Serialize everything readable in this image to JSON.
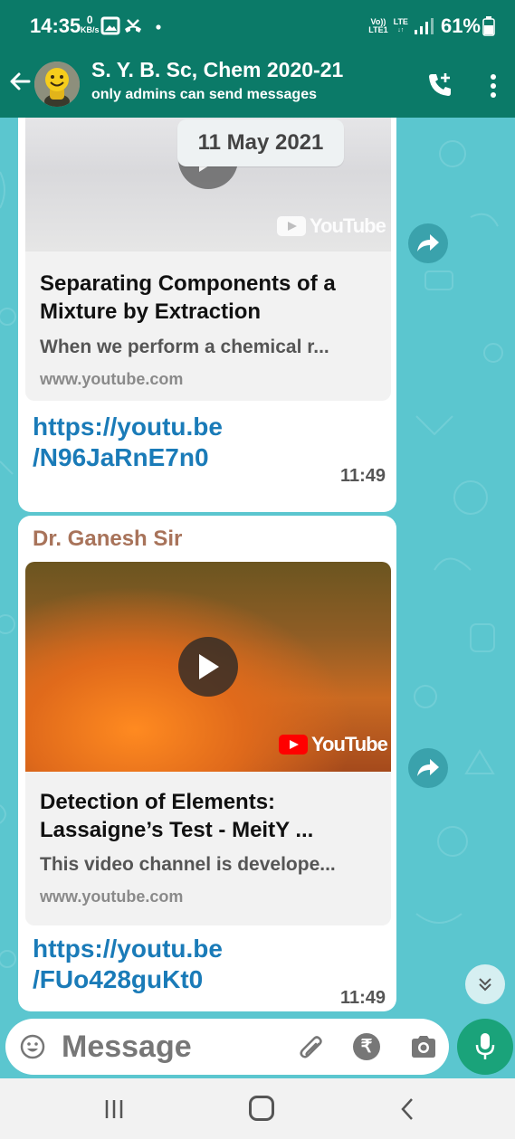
{
  "status_bar": {
    "time": "14:35",
    "net_speed_value": "0",
    "net_speed_unit": "KB/s",
    "dot": "•",
    "volte_top": "Vo))",
    "volte_bottom": "LTE1",
    "lte": "LTE",
    "battery": "61%"
  },
  "header": {
    "title": "S. Y. B. Sc, Chem 2020-21",
    "subtitle": "only admins can send messages",
    "icons": [
      "back-arrow-icon",
      "avatar",
      "add-call-icon",
      "more-vertical-icon"
    ]
  },
  "chat": {
    "date_chip": "11 May 2021",
    "messages": [
      {
        "sender": "",
        "preview_title": "Separating Components of a Mixture by Extraction",
        "preview_description": "When we perform a chemical r...",
        "preview_domain": "www.youtube.com",
        "youtube_label": "YouTube",
        "url_line1": "https://youtu.be",
        "url_line2": "/N96JaRnE7n0",
        "time": "11:49"
      },
      {
        "sender": "Dr. Ganesh Sir",
        "preview_title": "Detection of Elements: Lassaigne’s Test - MeitY ...",
        "preview_description": "This video channel is develope...",
        "preview_domain": "www.youtube.com",
        "youtube_label": "YouTube",
        "url_line1": "https://youtu.be",
        "url_line2": "/FUo428guKt0",
        "time": "11:49"
      }
    ]
  },
  "input_bar": {
    "placeholder": "Message",
    "rupee_symbol": "₹"
  },
  "colors": {
    "header_green": "#0b7a68",
    "chat_background": "#5bc6cf",
    "link_blue": "#1a7bb8",
    "sender_brown": "#a8735a",
    "mic_green": "#1aa37a"
  }
}
